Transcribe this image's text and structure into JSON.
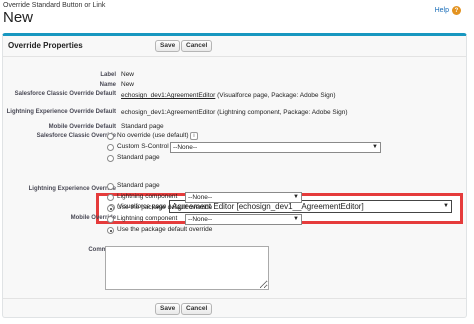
{
  "header": {
    "breadcrumb": "Override Standard Button or Link",
    "title": "New",
    "help": "Help"
  },
  "panel": {
    "title": "Override Properties",
    "save": "Save",
    "cancel": "Cancel"
  },
  "fields": {
    "label_label": "Label",
    "label_value": "New",
    "name_label": "Name",
    "name_value": "New",
    "classic_default_label": "Salesforce Classic Override Default",
    "classic_default_link": "echosign_dev1:AgreementEditor",
    "classic_default_suffix": " (Visualforce page, Package: Adobe Sign)",
    "lightning_default_label": "Lightning Experience Override Default",
    "lightning_default_value": "echosign_dev1:AgreementEditor (Lightning component, Package: Adobe Sign)",
    "mobile_default_label": "Mobile Override Default",
    "mobile_default_value": "Standard page",
    "classic_override_label": "Salesforce Classic Override",
    "classic_opts": {
      "no_override": "No override (use default)",
      "s_control": "Custom S-Control",
      "s_control_select": "--None--",
      "standard": "Standard page",
      "visualforce": "Visualforce page",
      "visualforce_select": "Agreement Editor [echosign_dev1__AgreementEditor]"
    },
    "lightning_override_label": "Lightning Experience Override",
    "lightning_opts": {
      "standard": "Standard page",
      "component": "Lightning component",
      "component_select": "--None--",
      "package_default": "Use the package default override"
    },
    "mobile_override_label": "Mobile Override",
    "mobile_opts": {
      "component": "Lightning component",
      "component_select": "--None--",
      "package_default": "Use the package default override"
    },
    "comment_label": "Comment",
    "info_glyph": "i"
  },
  "icons": {
    "help": "help-icon",
    "dropdown": "chevron-down-icon"
  },
  "colors": {
    "accent": "#1797c0",
    "highlight": "#e53b3b",
    "help": "#e39320"
  }
}
